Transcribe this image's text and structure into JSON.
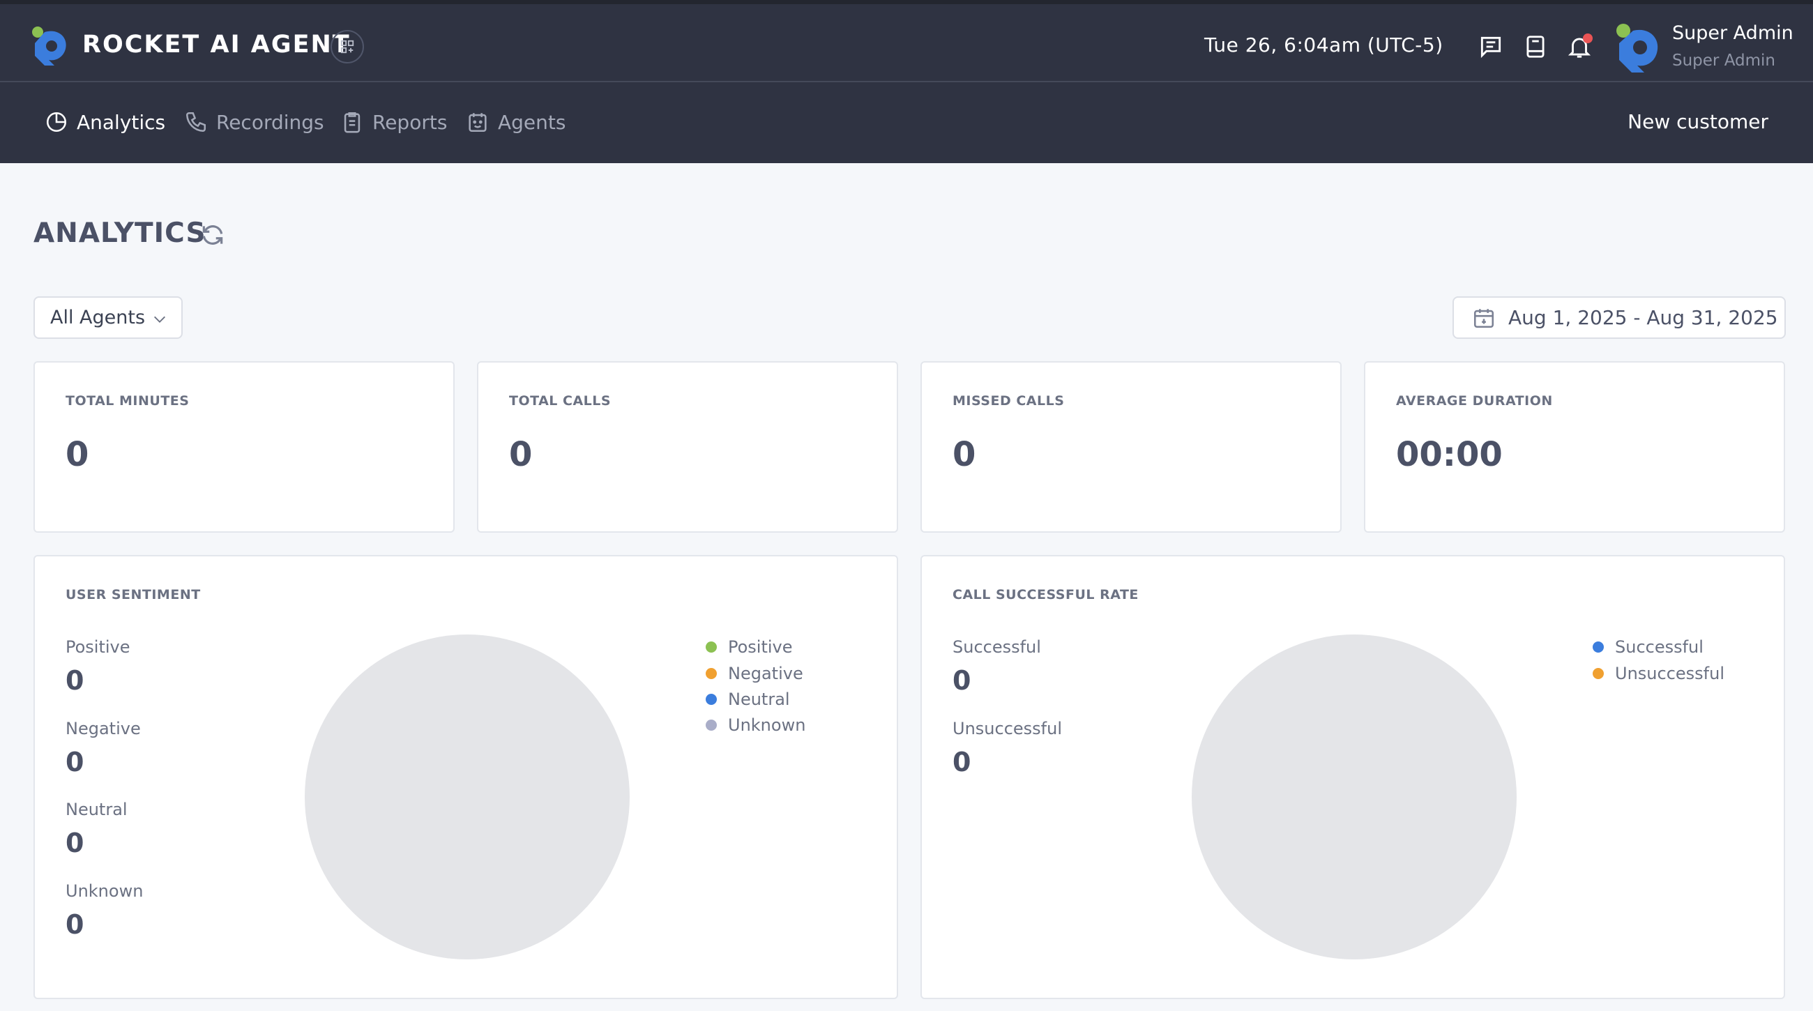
{
  "app": {
    "brand": "ROCKET AI AGENT",
    "datetime": "Tue 26, 6:04am (UTC-5)",
    "user_name": "Super Admin",
    "user_role": "Super Admin"
  },
  "nav": {
    "items": [
      {
        "label": "Analytics",
        "icon": "pie-chart-icon",
        "active": true
      },
      {
        "label": "Recordings",
        "icon": "phone-icon",
        "active": false
      },
      {
        "label": "Reports",
        "icon": "clipboard-icon",
        "active": false
      },
      {
        "label": "Agents",
        "icon": "calendar-face-icon",
        "active": false
      }
    ],
    "new_customer": "New customer"
  },
  "page": {
    "title": "ANALYTICS",
    "agent_filter": "All Agents",
    "date_range": "Aug 1, 2025 - Aug 31, 2025"
  },
  "metrics": [
    {
      "label": "TOTAL MINUTES",
      "value": "0"
    },
    {
      "label": "TOTAL CALLS",
      "value": "0"
    },
    {
      "label": "MISSED CALLS",
      "value": "0"
    },
    {
      "label": "AVERAGE DURATION",
      "value": "00:00"
    }
  ],
  "sentiment": {
    "title": "USER SENTIMENT",
    "stats": [
      {
        "label": "Positive",
        "value": "0"
      },
      {
        "label": "Negative",
        "value": "0"
      },
      {
        "label": "Neutral",
        "value": "0"
      },
      {
        "label": "Unknown",
        "value": "0"
      }
    ],
    "legend": [
      {
        "label": "Positive",
        "color": "#8cc152"
      },
      {
        "label": "Negative",
        "color": "#f0a030"
      },
      {
        "label": "Neutral",
        "color": "#3b7ddd"
      },
      {
        "label": "Unknown",
        "color": "#a9adc8"
      }
    ]
  },
  "success_rate": {
    "title": "CALL SUCCESSFUL RATE",
    "stats": [
      {
        "label": "Successful",
        "value": "0"
      },
      {
        "label": "Unsuccessful",
        "value": "0"
      }
    ],
    "legend": [
      {
        "label": "Successful",
        "color": "#3b7ddd"
      },
      {
        "label": "Unsuccessful",
        "color": "#f0a030"
      }
    ]
  },
  "colors": {
    "header_bg": "#2f3342",
    "page_bg": "#f5f7fa",
    "notification": "#ea5455",
    "brand_green": "#8cc152",
    "brand_blue": "#3b7ddd"
  }
}
